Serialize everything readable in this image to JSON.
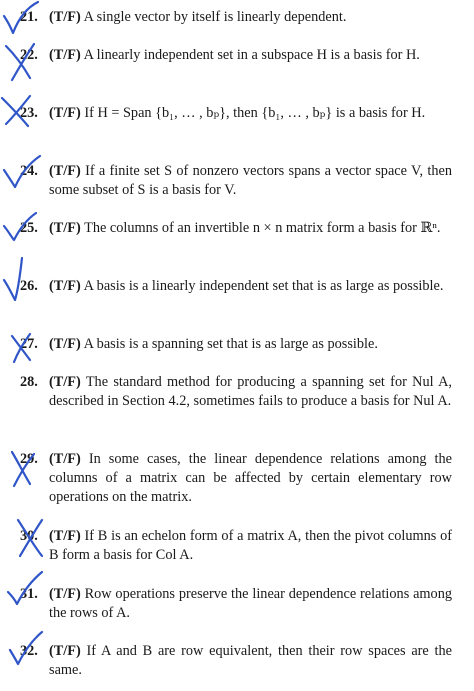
{
  "mark_color": "#2f55c8",
  "items": [
    {
      "num": "21.",
      "tf": "(T/F)",
      "text": "A single vector by itself is linearly dependent.",
      "mark": "check"
    },
    {
      "num": "22.",
      "tf": "(T/F)",
      "text": "A linearly independent set in a subspace H is a basis for H.",
      "mark": "cross"
    },
    {
      "num": "23.",
      "tf": "(T/F)",
      "text": "If H = Span {b₁, … , bₚ}, then {b₁, … , bₚ} is a basis for H.",
      "mark": "cross"
    },
    {
      "num": "24.",
      "tf": "(T/F)",
      "text": "If a finite set S of nonzero vectors spans a vector space V, then some subset of S is a basis for V.",
      "mark": "check"
    },
    {
      "num": "25.",
      "tf": "(T/F)",
      "text": "The columns of an invertible n × n matrix form a basis for ℝⁿ.",
      "mark": "check"
    },
    {
      "num": "26.",
      "tf": "(T/F)",
      "text": "A basis is a linearly independent set that is as large as possible.",
      "mark": "check"
    },
    {
      "num": "27.",
      "tf": "(T/F)",
      "text": "A basis is a spanning set that is as large as possible.",
      "mark": "cross"
    },
    {
      "num": "28.",
      "tf": "(T/F)",
      "text": "The standard method for producing a spanning set for Nul A, described in Section 4.2, sometimes fails to produce a basis for Nul A.",
      "mark": "none"
    },
    {
      "num": "29.",
      "tf": "(T/F)",
      "text": "In some cases, the linear dependence relations among the columns of a matrix can be affected by certain elementary row operations on the matrix.",
      "mark": "cross"
    },
    {
      "num": "30.",
      "tf": "(T/F)",
      "text": "If B is an echelon form of a matrix A, then the pivot columns of B form a basis for Col A.",
      "mark": "cross"
    },
    {
      "num": "31.",
      "tf": "(T/F)",
      "text": "Row operations preserve the linear dependence relations among the rows of A.",
      "mark": "check"
    },
    {
      "num": "32.",
      "tf": "(T/F)",
      "text": "If A and B are row equivalent, then their row spaces are the same.",
      "mark": "check"
    }
  ]
}
